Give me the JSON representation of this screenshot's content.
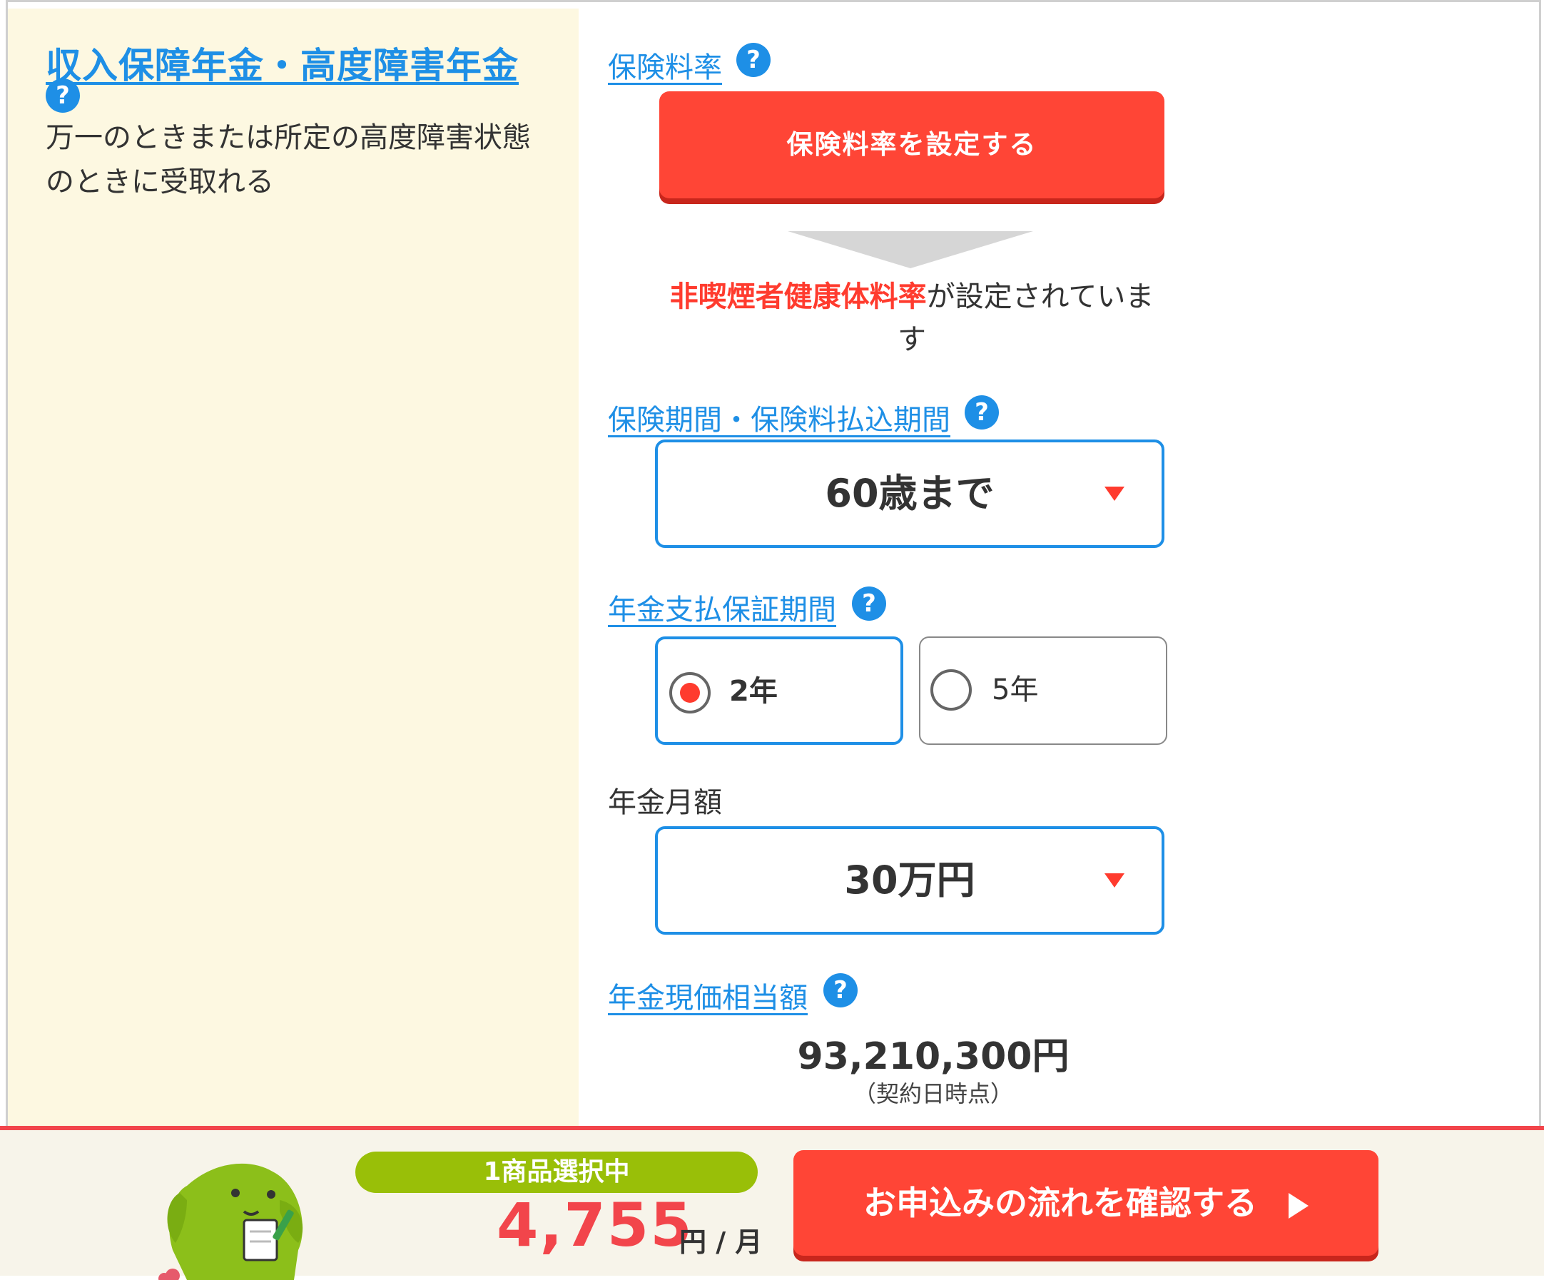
{
  "product": {
    "title": "収入保障年金・高度障害年金",
    "help": "?",
    "description": "万一のときまたは所定の高度障害状態のときに受取れる"
  },
  "rate": {
    "label": "保険料率",
    "help": "?",
    "button_label": "保険料率を設定する",
    "status_highlight": "非喫煙者健康体料率",
    "status_rest": "が設定されています"
  },
  "period": {
    "label": "保険期間・保険料払込期間",
    "help": "?",
    "selected": "60歳まで"
  },
  "guarantee": {
    "label": "年金支払保証期間",
    "help": "?",
    "options": [
      "2年",
      "5年"
    ],
    "selected": "2年"
  },
  "monthly": {
    "label": "年金月額",
    "selected": "30万円"
  },
  "present_value": {
    "label": "年金現価相当額",
    "help": "?",
    "amount": "93,210,300円",
    "note": "（契約日時点）"
  },
  "footer": {
    "badge": "1商品選択中",
    "price": "4,755",
    "unit": "円 / 月",
    "apply_label": "お申込みの流れを確認する"
  },
  "colors": {
    "accent_blue": "#1e8fe6",
    "accent_red": "#ff4536",
    "badge_green": "#99bf08",
    "left_bg": "#fdf8e1"
  }
}
